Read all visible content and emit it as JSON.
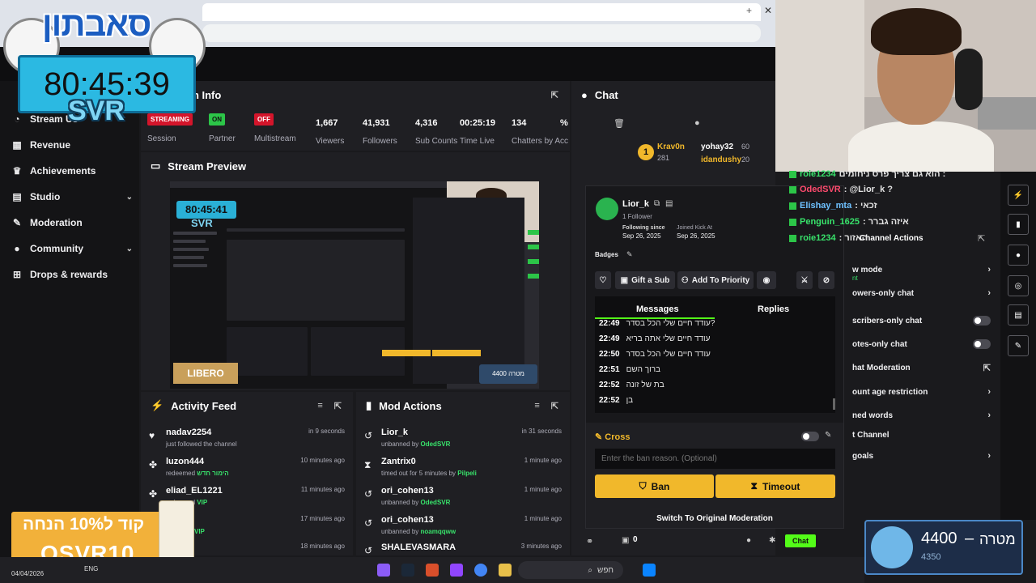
{
  "browser": {
    "close": "✕",
    "plus": "+"
  },
  "sidebar": {
    "items": [
      {
        "label": "Stream Us"
      },
      {
        "label": "Revenue"
      },
      {
        "label": "Achievements"
      },
      {
        "label": "Studio"
      },
      {
        "label": "Moderation"
      },
      {
        "label": "Community"
      },
      {
        "label": "Drops & rewards"
      }
    ]
  },
  "stream_info": {
    "title": "on Info",
    "session_badge": "STREAMING",
    "session_label": "Session",
    "partner_badge": "ON",
    "partner_label": "Partner",
    "multistream_badge": "OFF",
    "multistream_label": "Multistream",
    "viewers": "1,667",
    "viewers_label": "Viewers",
    "followers": "41,931",
    "followers_label": "Followers",
    "subs": "4,316",
    "subs_label": "Sub Counts",
    "time": "00:25:19",
    "time_label": "Time Live",
    "chatters": "134",
    "chatters_label": "Chatters by Acc",
    "pct": "%"
  },
  "preview": {
    "title": "Stream Preview",
    "timer": "80:45:41",
    "svr": "SVR",
    "brand": "LIBERO",
    "goal": "4400 מטרה"
  },
  "activity": {
    "title": "Activity Feed",
    "items": [
      {
        "name": "nadav2254",
        "desc": "just followed the channel",
        "highlight": "",
        "time": "in 9 seconds"
      },
      {
        "name": "luzon444",
        "desc": "redeemed",
        "highlight": "הימור חדש",
        "time": "10 minutes ago"
      },
      {
        "name": "eliad_EL1221",
        "desc": "redeemed",
        "highlight": "VIP",
        "time": "11 minutes ago"
      },
      {
        "name": "",
        "desc": "",
        "highlight": "VIP",
        "time": "17 minutes ago"
      },
      {
        "name": "",
        "desc": "",
        "highlight": "",
        "time": "18 minutes ago"
      }
    ]
  },
  "mod_actions": {
    "title": "Mod Actions",
    "items": [
      {
        "name": "Lior_k",
        "desc": "unbanned by",
        "by": "OdedSVR",
        "time": "in 31 seconds"
      },
      {
        "name": "Zantrix0",
        "desc": "timed out for 5 minutes by",
        "by": "Pilpeli",
        "time": "1 minute ago"
      },
      {
        "name": "ori_cohen13",
        "desc": "unbanned by",
        "by": "OdedSVR",
        "time": "1 minute ago"
      },
      {
        "name": "ori_cohen13",
        "desc": "unbanned by",
        "by": "noamqqww",
        "time": "1 minute ago"
      },
      {
        "name": "SHALEVASMARA",
        "desc": "",
        "by": "",
        "time": "3 minutes ago"
      }
    ]
  },
  "chat": {
    "title": "Chat",
    "leaderboard": [
      {
        "name": "Krav0n",
        "count": "281"
      },
      {
        "name": "yohay32",
        "count": "60"
      },
      {
        "name": "idandushy",
        "count": "20"
      }
    ],
    "rank": "1",
    "footer_count": "0",
    "footer_button": "Chat"
  },
  "user_card": {
    "username": "Lior_k",
    "followers": "1 Follower",
    "following_label": "Following since",
    "following_date": "Sep 26, 2025",
    "joined_label": "Joined Kick At",
    "joined_date": "Sep 26, 2025",
    "badges_label": "Badges",
    "gift_sub": "Gift a Sub",
    "add_priority": "Add To Priority",
    "tab_messages": "Messages",
    "tab_replies": "Replies",
    "messages": [
      {
        "time": "22:49",
        "text": "עודד חיים שלי הכל בסדר?"
      },
      {
        "time": "22:49",
        "text": "עודד חיים שלי אתה בריא"
      },
      {
        "time": "22:50",
        "text": "עודד חיים שלי הכל בסדר"
      },
      {
        "time": "22:51",
        "text": "ברוך השם"
      },
      {
        "time": "22:52",
        "text": "בת של זונה"
      },
      {
        "time": "22:52",
        "text": "בן"
      }
    ],
    "cross_label": "Cross",
    "ban_reason_placeholder": "Enter the ban reason. (Optional)",
    "ban": "Ban",
    "timeout": "Timeout",
    "switch": "Switch To Original Moderation"
  },
  "overlay_chat": [
    {
      "name": "roie1234",
      "text": "הוא גם צריך פרס ניחומים :",
      "color": "#e3e3e3"
    },
    {
      "name": "OdedSVR",
      "text": ": @Lior_k ?",
      "color": "#ff4b6e"
    },
    {
      "name": "Elishay_mta",
      "text": ": זכאי",
      "color": "#6ec1ff"
    },
    {
      "name": "Penguin_1625",
      "text": ": איזה גברר",
      "color": "#38e36b"
    },
    {
      "name": "roie1234",
      "text": ": האזור",
      "color": "#e3e3e3"
    }
  ],
  "chat_actions": {
    "title": "Channel Actions",
    "rows": [
      {
        "label": "w mode",
        "sub": "nt"
      },
      {
        "label": "owers-only chat",
        "sub": ""
      },
      {
        "label": "scribers-only chat",
        "sub": ""
      },
      {
        "label": "otes-only chat",
        "sub": ""
      },
      {
        "label": "hat Moderation",
        "sub": ""
      },
      {
        "label": "ount age restriction",
        "sub": ""
      },
      {
        "label": "ned words",
        "sub": ""
      },
      {
        "label": "t Channel",
        "sub": ""
      },
      {
        "label": "goals",
        "sub": ""
      }
    ]
  },
  "overlays": {
    "logo": "סאבתון",
    "timer": "80:45:39",
    "svr": "SVR",
    "promo_line1": "קוד ל10% הנחה",
    "promo_line2": "OSVR10",
    "goal_value": "4400",
    "goal_label": "מטרה",
    "goal_dash": "–",
    "goal_sub": "4350"
  },
  "taskbar": {
    "date": "04/04/2026",
    "lang": "ENG",
    "search": "חפש"
  },
  "colors": {
    "green": "#2cc548",
    "yellow": "#f1b82b",
    "red": "#d4152b",
    "blue": "#2bb9e2"
  }
}
